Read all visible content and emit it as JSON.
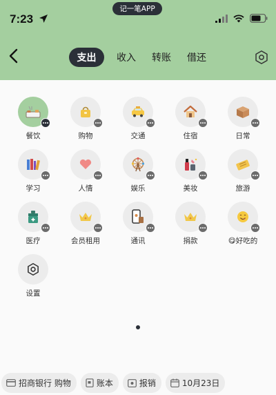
{
  "status_bar": {
    "time": "7:23",
    "island_label": "记一笔APP"
  },
  "header": {
    "tabs": [
      {
        "label": "支出",
        "active": true
      },
      {
        "label": "收入",
        "active": false
      },
      {
        "label": "转账",
        "active": false
      },
      {
        "label": "借还",
        "active": false
      }
    ]
  },
  "categories": [
    {
      "label": "餐饮",
      "icon": "meal-icon",
      "selected": true
    },
    {
      "label": "购物",
      "icon": "shopping-bag-icon"
    },
    {
      "label": "交通",
      "icon": "taxi-icon"
    },
    {
      "label": "住宿",
      "icon": "house-icon"
    },
    {
      "label": "日常",
      "icon": "box-icon"
    },
    {
      "label": "学习",
      "icon": "books-icon"
    },
    {
      "label": "人情",
      "icon": "heart-gift-icon"
    },
    {
      "label": "娱乐",
      "icon": "ferris-wheel-icon"
    },
    {
      "label": "美妆",
      "icon": "cosmetics-icon"
    },
    {
      "label": "旅游",
      "icon": "ticket-icon"
    },
    {
      "label": "医疗",
      "icon": "medical-kit-icon"
    },
    {
      "label": "会员租用",
      "icon": "crown-icon"
    },
    {
      "label": "通讯",
      "icon": "phone-icon"
    },
    {
      "label": "捐款",
      "icon": "crown-icon"
    },
    {
      "label": "😋好吃的",
      "icon": "smiley-icon"
    },
    {
      "label": "设置",
      "icon": "gear-icon"
    }
  ],
  "bottom_bar": {
    "account": "招商银行 购物",
    "book": "账本",
    "reimburse": "报销",
    "date": "10月23日"
  },
  "colors": {
    "accent": "#a4cf9f",
    "dark": "#2b3038",
    "chip": "#ececec"
  }
}
